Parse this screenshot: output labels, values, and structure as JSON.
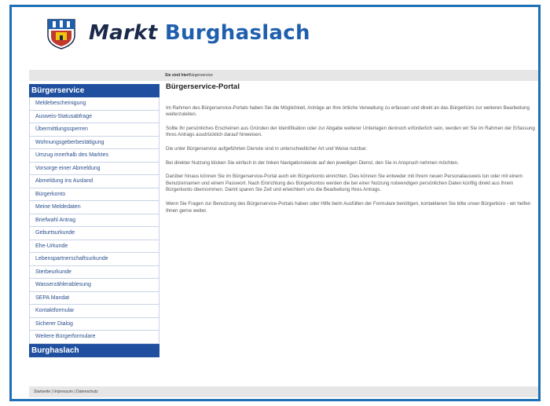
{
  "header": {
    "brand_prefix": "Markt",
    "brand_name": "Burghaslach"
  },
  "breadcrumb": {
    "label": "Sie sind hier:",
    "value": "Bürgerservice"
  },
  "sidebar": {
    "section_title": "Bürgerservice",
    "items": [
      "Meldebescheinigung",
      "Ausweis-Statusabfrage",
      "Übermittlungssperren",
      "Wohnungsgeberbestätigung",
      "Umzug innerhalb des Marktes",
      "Vorsorge einer Abmeldung",
      "Abmeldung ins Ausland",
      "Bürgerkonto",
      "Meine Meldedaten",
      "Briefwahl Antrag",
      "Geburtsurkunde",
      "Ehe-Urkunde",
      "Lebenspartnerschaftsurkunde",
      "Sterbeurkunde",
      "Wasserzählerablesung",
      "SEPA Mandat",
      "Kontaktformular",
      "Sicherer Dialog",
      "Weitere Bürgerformulare"
    ],
    "footer_section_title": "Burghaslach"
  },
  "main": {
    "title": "Bürgerservice-Portal",
    "paragraphs": [
      "Im Rahmen des Bürgerservice-Portals haben Sie die Möglichkeit, Anträge an Ihre örtliche Verwaltung zu erfassen und direkt an das Bürgerbüro zur weiteren Bearbeitung weiterzuleiten.",
      "Sollte Ihr persönliches Erscheinen aus Gründen der Identifikation oder zur Abgabe weiterer Unterlagen dennoch erforderlich sein, werden wir Sie im Rahmen der Erfassung Ihres Antrags ausdrücklich darauf hinweisen.",
      "Die unter Bürgerservice aufgeführten Dienste sind in unterschiedlicher Art und Weise nutzbar.",
      "Bei direkter Nutzung klicken Sie einfach in der linken Navigationsleiste auf den jeweiligen Dienst, den Sie in Anspruch nehmen möchten.",
      "Darüber hinaus können Sie im Bürgerservice-Portal auch ein Bürgerkonto einrichten. Dies können Sie entweder mit Ihrem neuen Personalausweis tun oder mit einem Benutzernamen und einem Passwort. Nach Einrichtung des Bürgerkontos werden die bei einer Nutzung notwendigen persönlichen Daten künftig direkt aus Ihrem Bürgerkonto übernommen. Damit sparen Sie Zeit und erleichtern uns die Bearbeitung Ihres Antrags.",
      "Wenn Sie Fragen zur Benutzung des Bürgerservice-Portals haben oder Hilfe beim Ausfüllen der Formulare benötigen, kontaktieren Sie bitte unser Bürgerbüro - wir helfen Ihnen gerne weiter."
    ]
  },
  "footer": {
    "links": "Startseite | Impressum | Datenschutz"
  },
  "colors": {
    "frame": "#1f6fb7",
    "sidebar_header": "#1f4f9e",
    "brand_blue": "#1f5fae",
    "link": "#2b4f8e"
  }
}
